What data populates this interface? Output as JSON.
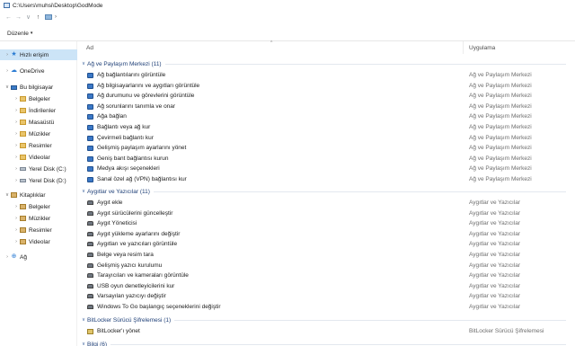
{
  "window": {
    "title": "C:\\Users\\muhsi\\Desktop\\GodMode"
  },
  "toolbar": {
    "back": "←",
    "forward": "→",
    "recent": "∨",
    "up": "↑",
    "addr_chevron": "›"
  },
  "command_bar": {
    "organize_label": "Düzenle",
    "organize_caret": "▾"
  },
  "columns": {
    "name": "Ad",
    "category": "Uygulama",
    "sort_glyph": "^"
  },
  "nav": {
    "items": [
      {
        "label": "Hızlı erişim",
        "icon": "quick-access-star-icon",
        "glyph": "★",
        "expander": "›"
      },
      {
        "label": "OneDrive",
        "icon": "onedrive-cloud-icon",
        "glyph": "☁",
        "expander": "›"
      },
      {
        "label": "Bu bilgisayar",
        "icon": "this-pc-icon",
        "glyph": "",
        "expander": "∨"
      },
      {
        "label": "Belgeler",
        "icon": "documents-folder-icon",
        "glyph": "",
        "expander": "›"
      },
      {
        "label": "İndirilenler",
        "icon": "downloads-folder-icon",
        "glyph": "",
        "expander": "›"
      },
      {
        "label": "Masaüstü",
        "icon": "desktop-folder-icon",
        "glyph": "",
        "expander": "›"
      },
      {
        "label": "Müzikler",
        "icon": "music-folder-icon",
        "glyph": "",
        "expander": "›"
      },
      {
        "label": "Resimler",
        "icon": "pictures-folder-icon",
        "glyph": "",
        "expander": "›"
      },
      {
        "label": "Videolar",
        "icon": "videos-folder-icon",
        "glyph": "",
        "expander": "›"
      },
      {
        "label": "Yerel Disk (C:)",
        "icon": "local-disk-c-icon",
        "glyph": "",
        "expander": "›"
      },
      {
        "label": "Yerel Disk (D:)",
        "icon": "local-disk-d-icon",
        "glyph": "",
        "expander": "›"
      },
      {
        "label": "Kitaplıklar",
        "icon": "libraries-icon",
        "glyph": "",
        "expander": "∨"
      },
      {
        "label": "Belgeler",
        "icon": "library-documents-icon",
        "glyph": "",
        "expander": "›"
      },
      {
        "label": "Müzikler",
        "icon": "library-music-icon",
        "glyph": "",
        "expander": "›"
      },
      {
        "label": "Resimler",
        "icon": "library-pictures-icon",
        "glyph": "",
        "expander": "›"
      },
      {
        "label": "Videolar",
        "icon": "library-videos-icon",
        "glyph": "",
        "expander": "›"
      },
      {
        "label": "Ağ",
        "icon": "network-icon",
        "glyph": "⊕",
        "expander": "›"
      }
    ]
  },
  "groups": [
    {
      "title": "Ağ ve Paylaşım Merkezi (11)",
      "items": [
        {
          "name": "Ağ bağlantılarını görüntüle",
          "category": "Ağ ve Paylaşım Merkezi"
        },
        {
          "name": "Ağ bilgisayarlarını ve aygıtları görüntüle",
          "category": "Ağ ve Paylaşım Merkezi"
        },
        {
          "name": "Ağ durumunu ve görevlerini görüntüle",
          "category": "Ağ ve Paylaşım Merkezi"
        },
        {
          "name": "Ağ sorunlarını tanımla ve onar",
          "category": "Ağ ve Paylaşım Merkezi"
        },
        {
          "name": "Ağa bağlan",
          "category": "Ağ ve Paylaşım Merkezi"
        },
        {
          "name": "Bağlantı veya ağ kur",
          "category": "Ağ ve Paylaşım Merkezi"
        },
        {
          "name": "Çevirmeli bağlantı kur",
          "category": "Ağ ve Paylaşım Merkezi"
        },
        {
          "name": "Gelişmiş paylaşım ayarlarını yönet",
          "category": "Ağ ve Paylaşım Merkezi"
        },
        {
          "name": "Geniş bant bağlantısı kurun",
          "category": "Ağ ve Paylaşım Merkezi"
        },
        {
          "name": "Medya akışı seçenekleri",
          "category": "Ağ ve Paylaşım Merkezi"
        },
        {
          "name": "Sanal özel ağ (VPN) bağlantısı kur",
          "category": "Ağ ve Paylaşım Merkezi"
        }
      ]
    },
    {
      "title": "Aygıtlar ve Yazıcılar (11)",
      "items": [
        {
          "name": "Aygıt ekle",
          "category": "Aygıtlar ve Yazıcılar"
        },
        {
          "name": "Aygıt sürücülerini güncelleştir",
          "category": "Aygıtlar ve Yazıcılar"
        },
        {
          "name": "Aygıt Yöneticisi",
          "category": "Aygıtlar ve Yazıcılar"
        },
        {
          "name": "Aygıt yükleme ayarlarını değiştir",
          "category": "Aygıtlar ve Yazıcılar"
        },
        {
          "name": "Aygıtları ve yazıcıları görüntüle",
          "category": "Aygıtlar ve Yazıcılar"
        },
        {
          "name": "Belge veya resim tara",
          "category": "Aygıtlar ve Yazıcılar"
        },
        {
          "name": "Gelişmiş yazıcı kurulumu",
          "category": "Aygıtlar ve Yazıcılar"
        },
        {
          "name": "Tarayıcıları ve kameraları görüntüle",
          "category": "Aygıtlar ve Yazıcılar"
        },
        {
          "name": "USB oyun denetleyicilerini kur",
          "category": "Aygıtlar ve Yazıcılar"
        },
        {
          "name": "Varsayılan yazıcıyı değiştir",
          "category": "Aygıtlar ve Yazıcılar"
        },
        {
          "name": "Windows To Go başlangıç seçeneklerini değiştir",
          "category": "Aygıtlar ve Yazıcılar"
        }
      ]
    },
    {
      "title": "BitLocker Sürücü Şifrelemesi (1)",
      "items": [
        {
          "name": "BitLocker'ı yönet",
          "category": "BitLocker Sürücü Şifrelemesi"
        }
      ]
    },
    {
      "title": "Bilgi (6)",
      "items": []
    }
  ]
}
